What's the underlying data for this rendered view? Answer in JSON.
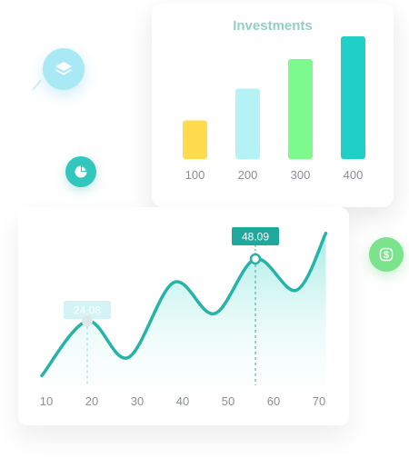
{
  "icons": {
    "layers": "layers-icon",
    "pie": "pie-chart-icon",
    "dollar": "dollar-icon"
  },
  "colors": {
    "teal": "#26b3a8",
    "title": "#93cfc7",
    "bar_colors": [
      "#ffdb4d",
      "#b5f2f5",
      "#7dfa8d",
      "#20cfc5"
    ]
  },
  "chart_data": [
    {
      "type": "bar",
      "title": "Investments",
      "categories": [
        "100",
        "200",
        "300",
        "400"
      ],
      "values": [
        17,
        31,
        44,
        54
      ],
      "ylim": [
        0,
        60
      ],
      "grid": false
    },
    {
      "type": "area",
      "x_ticks": [
        "10",
        "20",
        "30",
        "40",
        "50",
        "60",
        "70"
      ],
      "xlim": [
        10,
        70
      ],
      "x": [
        9,
        19,
        28,
        38,
        47,
        56,
        65,
        71.5
      ],
      "y": [
        3,
        24.08,
        10,
        39,
        27,
        48.09,
        36,
        58
      ],
      "ylim": [
        0,
        62
      ],
      "annotations": [
        {
          "x": 19,
          "label": "24.08"
        },
        {
          "x": 56,
          "label": "48.09"
        }
      ],
      "grid": false
    }
  ]
}
